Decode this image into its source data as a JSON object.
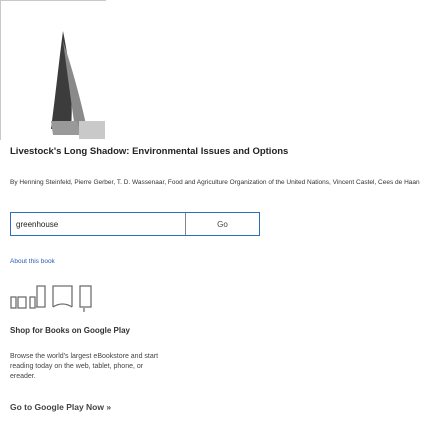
{
  "book": {
    "title": "Livestock's Long Shadow: Environmental Issues and Options",
    "byline": "By Henning Steinfeld, Pierre Gerber, T. D. Wassenaar, Food and Agriculture Organization of the United Nations, Vincent Castel, Cees de Haan"
  },
  "search": {
    "value": "greenhouse",
    "button_label": "Go"
  },
  "about_link": "About this book",
  "promo": {
    "heading": "Shop for Books on Google Play",
    "description": "Browse the world's largest eBookstore and start reading today on the web, tablet, phone, or ereader.",
    "cta": "Go to Google Play Now »"
  },
  "colors": {
    "accent": "#2c6fb6",
    "link": "#2a5db0"
  }
}
